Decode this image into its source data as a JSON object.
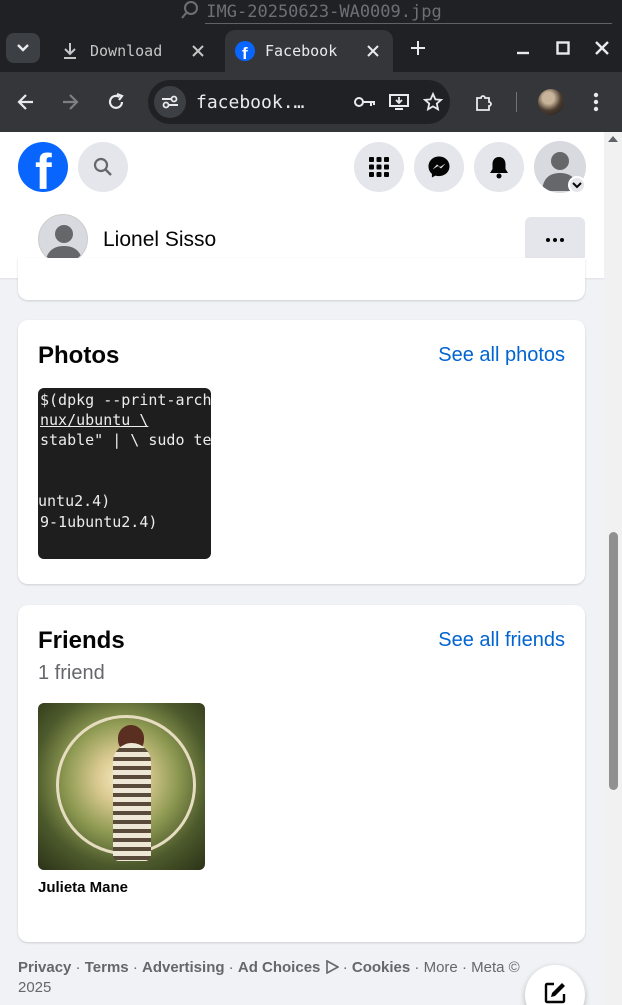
{
  "window": {
    "title": "IMG-20250623-WA0009.jpg"
  },
  "tabs": [
    {
      "label": "Download",
      "icon": "download-icon"
    },
    {
      "label": "Facebook",
      "icon": "facebook-favicon"
    }
  ],
  "toolbar": {
    "url": "facebook.…"
  },
  "fb": {
    "brand_color": "#0866ff",
    "logo_letter": "f"
  },
  "profile": {
    "name": "Lionel Sisso"
  },
  "photos": {
    "title": "Photos",
    "see_all": "See all photos",
    "thumbnail_lines": [
      "$(dpkg --print-arch",
      "nux/ubuntu \\",
      "stable\" | \\ sudo te",
      "untu2.4)",
      "9-1ubuntu2.4)"
    ]
  },
  "friends": {
    "title": "Friends",
    "see_all": "See all friends",
    "count": "1 friend",
    "list": [
      {
        "name": "Julieta Mane"
      }
    ]
  },
  "footer": {
    "links": [
      "Privacy",
      "Terms",
      "Advertising",
      "Ad Choices",
      "Cookies"
    ],
    "more": "More",
    "meta": "Meta ©",
    "year": "2025"
  }
}
